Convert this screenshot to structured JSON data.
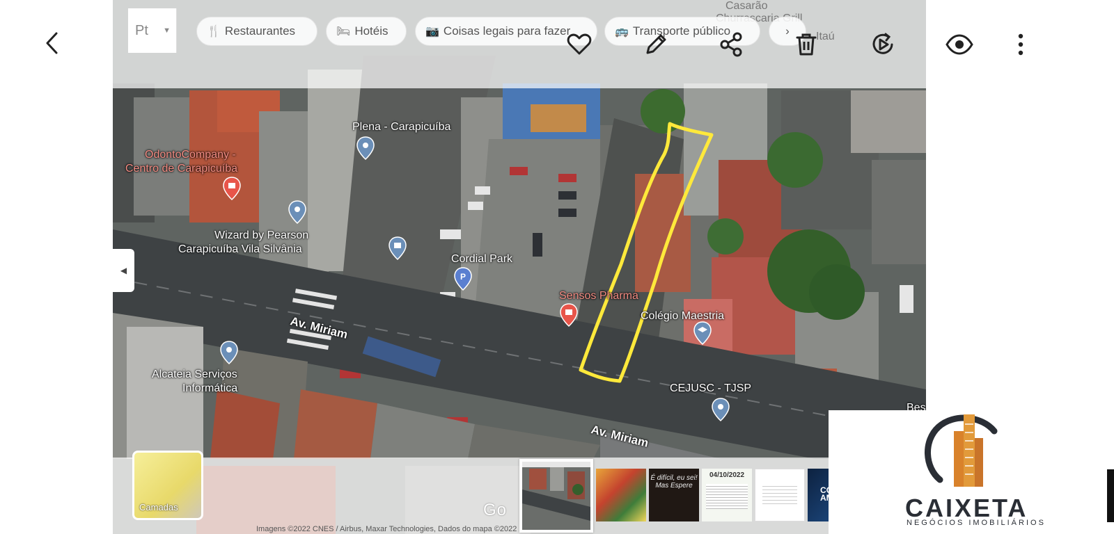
{
  "toolbar": {
    "back_icon": "chevron-left-icon",
    "favorite_icon": "heart-icon",
    "edit_icon": "pencil-icon",
    "share_icon": "share-icon",
    "delete_icon": "trash-icon",
    "remaster_icon": "motion-play-icon",
    "view_icon": "eye-icon",
    "more_icon": "more-vertical-icon"
  },
  "screenshot": {
    "lang_button": "Pt",
    "chips": [
      {
        "icon": "fork-knife-icon",
        "label": "Restaurantes"
      },
      {
        "icon": "bed-icon",
        "label": "Hotéis"
      },
      {
        "icon": "camera-icon",
        "label": "Coisas legais para fazer"
      },
      {
        "icon": "bus-icon",
        "label": "Transporte público"
      }
    ],
    "chip_more": "›",
    "places": {
      "casarao": "Casarão",
      "churrascaria": "Churrascaria Grill",
      "itau": "Itaú",
      "plena": "Plena - Carapicuíba",
      "odonto_1": "OdontoCompany -",
      "odonto_2": "Centro de Carapicuíba",
      "wizard_1": "Wizard by Pearson",
      "wizard_2": "Carapicuíba Vila Silvânia",
      "cordial": "Cordial Park",
      "sensos": "Sensos Pharma",
      "colegio": "Colégio Maestria",
      "alcateia_1": "Alcateia Serviços",
      "alcateia_2": "Informática",
      "cejusc": "CEJUSC - TJSP",
      "bes": "Bes"
    },
    "streets": [
      "Av. Miriam",
      "Av. Miriam"
    ],
    "layers_label": "Camadas",
    "google_mark": "Go",
    "credits": "Imagens ©2022 CNES / Airbus, Maxar Technologies, Dados do mapa ©2022"
  },
  "thumbnails": [
    {
      "kind": "map",
      "selected": true,
      "label": ""
    },
    {
      "kind": "illustration",
      "selected": false,
      "label": ""
    },
    {
      "kind": "quote",
      "selected": false,
      "label": "É difícil, eu sei! Mas Espere"
    },
    {
      "kind": "post",
      "selected": false,
      "label": "04/10/2022"
    },
    {
      "kind": "document",
      "selected": false,
      "label": ""
    },
    {
      "kind": "promo",
      "selected": false,
      "label": "COME AMAN"
    }
  ],
  "logo": {
    "name": "CAIXETA",
    "tagline": "NEGÓCIOS IMOBILIÁRIOS"
  },
  "colors": {
    "highlight": "#ffe93b",
    "logo_orange": "#d9822b",
    "logo_dark": "#2a2e35",
    "pin_blue": "#6b8fb8",
    "pin_red": "#e8554a"
  }
}
